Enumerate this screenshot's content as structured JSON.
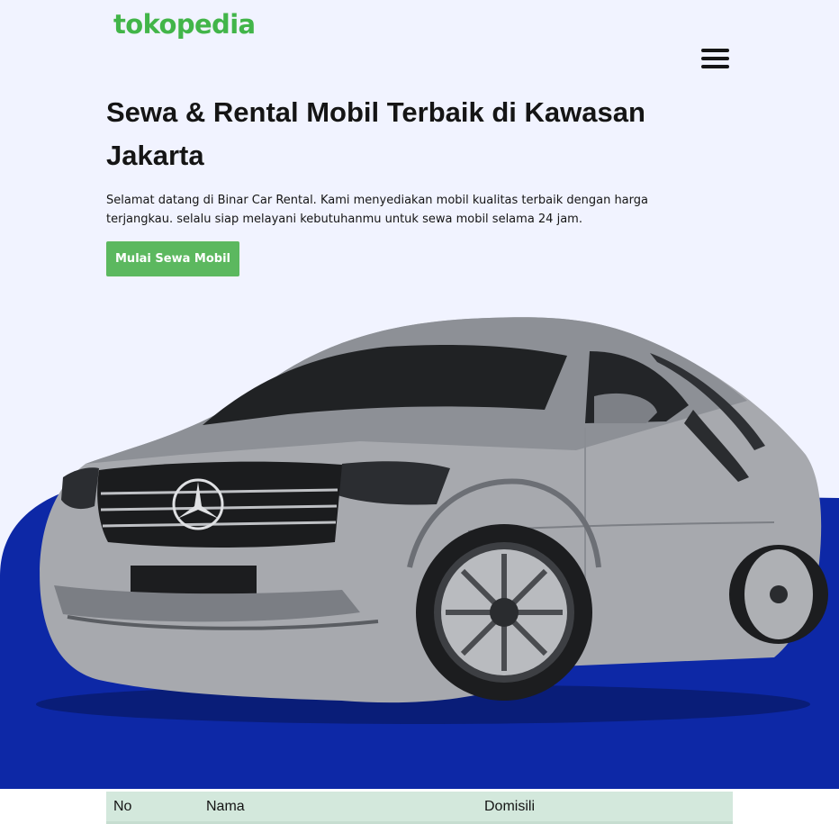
{
  "header": {
    "logo_text": "tokopedia",
    "menu_icon": "hamburger-menu-icon"
  },
  "hero": {
    "title": "Sewa & Rental Mobil Terbaik di Kawasan Jakarta",
    "subtitle": "Selamat datang di Binar Car Rental. Kami menyediakan mobil kualitas terbaik dengan harga terjangkau. selalu siap melayani kebutuhanmu untuk sewa mobil selama 24 jam.",
    "cta_label": "Mulai Sewa Mobil",
    "image": "car-image"
  },
  "table": {
    "headers": [
      "No",
      "Nama",
      "Domisili"
    ]
  },
  "colors": {
    "brand_green": "#42b549",
    "button_green": "#5cb85f",
    "hero_background": "#f1f3ff",
    "blue_shape": "#0d28a6",
    "table_header": "#d3e8dc"
  }
}
